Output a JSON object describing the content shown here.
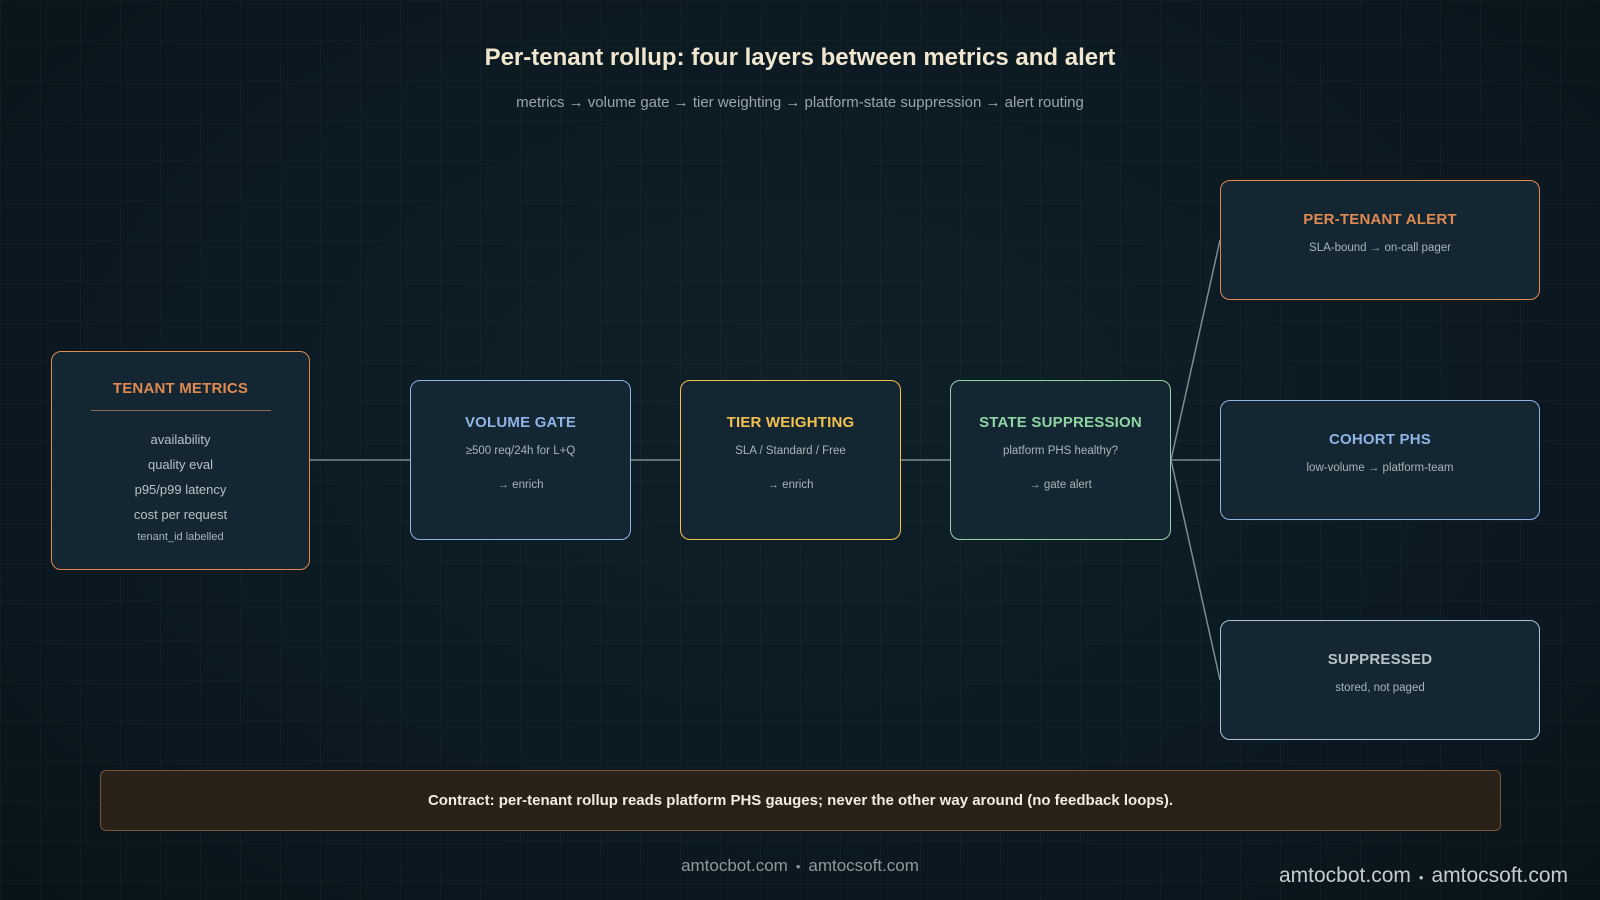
{
  "header": {
    "title": "Per-tenant rollup: four layers between metrics and alert",
    "subtitle": "metrics → volume gate → tier weighting → platform-state suppression → alert routing"
  },
  "nodes": {
    "tenant_metrics": {
      "title": "TENANT METRICS",
      "items": [
        "availability",
        "quality eval",
        "p95/p99 latency",
        "cost per request"
      ],
      "footnote": "tenant_id labelled"
    },
    "volume_gate": {
      "title": "VOLUME GATE",
      "line1": "≥500 req/24h for L+Q",
      "line2": "→ enrich"
    },
    "tier_weighting": {
      "title": "TIER WEIGHTING",
      "line1": "SLA / Standard / Free",
      "line2": "→ enrich"
    },
    "state_suppression": {
      "title": "STATE SUPPRESSION",
      "line1": "platform PHS healthy?",
      "line2": "→ gate alert"
    },
    "per_tenant_alert": {
      "title": "PER-TENANT ALERT",
      "line1": "SLA-bound → on-call pager"
    },
    "cohort_phs": {
      "title": "COHORT PHS",
      "line1": "low-volume → platform-team"
    },
    "suppressed": {
      "title": "SUPPRESSED",
      "line1": "stored, not paged"
    }
  },
  "contract": "Contract: per-tenant rollup reads platform PHS gauges; never the other way around (no feedback loops).",
  "footer": {
    "site_a": "amtocbot.com",
    "separator": "•",
    "site_b": "amtocsoft.com"
  },
  "colors": {
    "background": "#0d1b22",
    "orange": "#e08a52",
    "blue": "#8fb4e6",
    "yellow": "#f2c14e",
    "green": "#8fd4a3",
    "connector": "#7d8b92"
  }
}
